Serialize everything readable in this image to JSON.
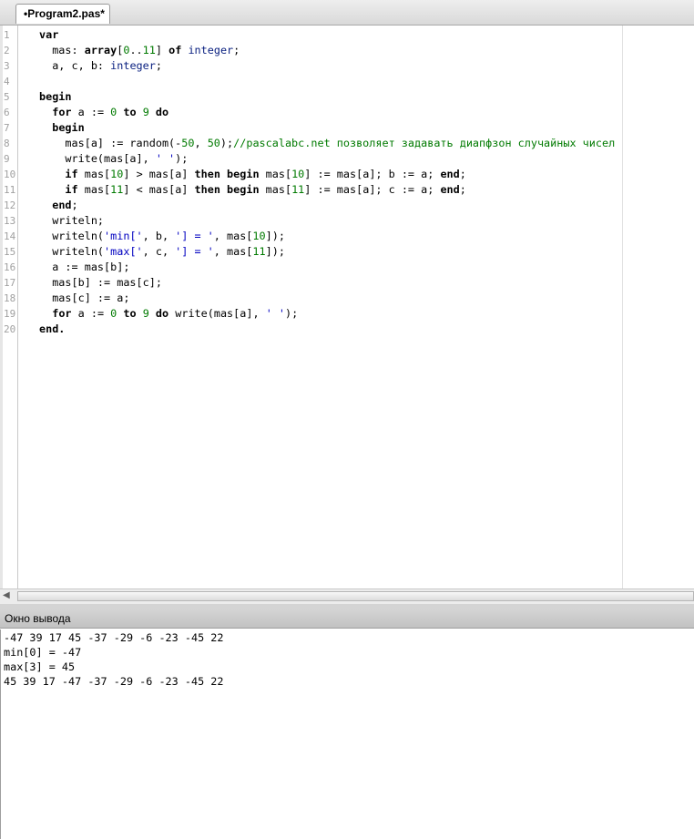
{
  "tab": {
    "title": "Program2.pas*",
    "dirty_marker": "•"
  },
  "editor": {
    "line_numbers": [
      "1",
      "2",
      "3",
      "4",
      "5",
      "6",
      "7",
      "8",
      "9",
      "10",
      "11",
      "12",
      "13",
      "14",
      "15",
      "16",
      "17",
      "18",
      "19",
      "20"
    ]
  },
  "code": [
    [
      [
        "kw",
        "var"
      ]
    ],
    [
      [
        "",
        "  mas: "
      ],
      [
        "kw",
        "array"
      ],
      [
        "",
        "["
      ],
      [
        "num",
        "0"
      ],
      [
        "",
        ".."
      ],
      [
        "num",
        "11"
      ],
      [
        "",
        "] "
      ],
      [
        "kw",
        "of"
      ],
      [
        "",
        " "
      ],
      [
        "ty",
        "integer"
      ],
      [
        "",
        ";"
      ]
    ],
    [
      [
        "",
        "  a, c, b: "
      ],
      [
        "ty",
        "integer"
      ],
      [
        "",
        ";"
      ]
    ],
    [],
    [
      [
        "kw",
        "begin"
      ]
    ],
    [
      [
        "",
        "  "
      ],
      [
        "kw",
        "for"
      ],
      [
        "",
        " a := "
      ],
      [
        "num",
        "0"
      ],
      [
        "",
        " "
      ],
      [
        "kw",
        "to"
      ],
      [
        "",
        " "
      ],
      [
        "num",
        "9"
      ],
      [
        "",
        " "
      ],
      [
        "kw",
        "do"
      ]
    ],
    [
      [
        "",
        "  "
      ],
      [
        "kw",
        "begin"
      ]
    ],
    [
      [
        "",
        "    mas[a] := random(-"
      ],
      [
        "num",
        "50"
      ],
      [
        "",
        ", "
      ],
      [
        "num",
        "50"
      ],
      [
        "",
        ");"
      ],
      [
        "cm",
        "//pascalabc.net позволяет задавать диапфзон случайных чисел"
      ]
    ],
    [
      [
        "",
        "    write(mas[a], "
      ],
      [
        "str",
        "' '"
      ],
      [
        "",
        ");"
      ]
    ],
    [
      [
        "",
        "    "
      ],
      [
        "kw",
        "if"
      ],
      [
        "",
        " mas["
      ],
      [
        "num",
        "10"
      ],
      [
        "",
        "] > mas[a] "
      ],
      [
        "kw",
        "then"
      ],
      [
        "",
        " "
      ],
      [
        "kw",
        "begin"
      ],
      [
        "",
        " mas["
      ],
      [
        "num",
        "10"
      ],
      [
        "",
        "] := mas[a]; b := a; "
      ],
      [
        "kw",
        "end"
      ],
      [
        "",
        ";"
      ]
    ],
    [
      [
        "",
        "    "
      ],
      [
        "kw",
        "if"
      ],
      [
        "",
        " mas["
      ],
      [
        "num",
        "11"
      ],
      [
        "",
        "] < mas[a] "
      ],
      [
        "kw",
        "then"
      ],
      [
        "",
        " "
      ],
      [
        "kw",
        "begin"
      ],
      [
        "",
        " mas["
      ],
      [
        "num",
        "11"
      ],
      [
        "",
        "] := mas[a]; c := a; "
      ],
      [
        "kw",
        "end"
      ],
      [
        "",
        ";"
      ]
    ],
    [
      [
        "",
        "  "
      ],
      [
        "kw",
        "end"
      ],
      [
        "",
        ";"
      ]
    ],
    [
      [
        "",
        "  writeln;"
      ]
    ],
    [
      [
        "",
        "  writeln("
      ],
      [
        "str",
        "'min['"
      ],
      [
        "",
        ", b, "
      ],
      [
        "str",
        "'] = '"
      ],
      [
        "",
        ", mas["
      ],
      [
        "num",
        "10"
      ],
      [
        "",
        "]);"
      ]
    ],
    [
      [
        "",
        "  writeln("
      ],
      [
        "str",
        "'max['"
      ],
      [
        "",
        ", c, "
      ],
      [
        "str",
        "'] = '"
      ],
      [
        "",
        ", mas["
      ],
      [
        "num",
        "11"
      ],
      [
        "",
        "]);"
      ]
    ],
    [
      [
        "",
        "  a := mas[b];"
      ]
    ],
    [
      [
        "",
        "  mas[b] := mas[c];"
      ]
    ],
    [
      [
        "",
        "  mas[c] := a;"
      ]
    ],
    [
      [
        "",
        "  "
      ],
      [
        "kw",
        "for"
      ],
      [
        "",
        " a := "
      ],
      [
        "num",
        "0"
      ],
      [
        "",
        " "
      ],
      [
        "kw",
        "to"
      ],
      [
        "",
        " "
      ],
      [
        "num",
        "9"
      ],
      [
        "",
        " "
      ],
      [
        "kw",
        "do"
      ],
      [
        "",
        " write(mas[a], "
      ],
      [
        "str",
        "' '"
      ],
      [
        "",
        ");"
      ]
    ],
    [
      [
        "kw",
        "end."
      ]
    ]
  ],
  "output_panel": {
    "title": "Окно вывода",
    "lines": [
      "-47 39 17 45 -37 -29 -6 -23 -45 22",
      "min[0] = -47",
      "max[3] = 45",
      "45 39 17 -47 -37 -29 -6 -23 -45 22"
    ]
  },
  "colors": {
    "keyword": "#000000",
    "type": "#0a2080",
    "number": "#007a00",
    "string": "#0000c0",
    "comment": "#007a00"
  }
}
